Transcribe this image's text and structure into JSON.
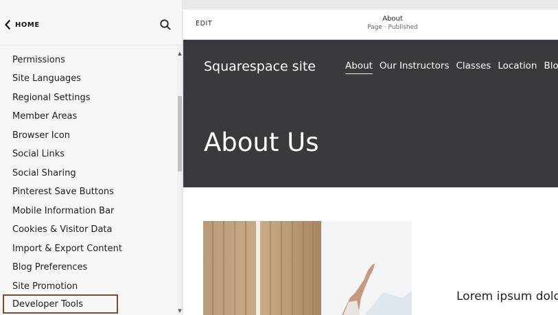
{
  "sidebar": {
    "back_label": "HOME",
    "items": [
      {
        "label": "Permissions"
      },
      {
        "label": "Site Languages"
      },
      {
        "label": "Regional Settings"
      },
      {
        "label": "Member Areas"
      },
      {
        "label": "Browser Icon"
      },
      {
        "label": "Social Links"
      },
      {
        "label": "Social Sharing"
      },
      {
        "label": "Pinterest Save Buttons"
      },
      {
        "label": "Mobile Information Bar"
      },
      {
        "label": "Cookies & Visitor Data"
      },
      {
        "label": "Import & Export Content"
      },
      {
        "label": "Blog Preferences"
      },
      {
        "label": "Site Promotion"
      },
      {
        "label": "Developer Tools",
        "highlighted": true
      }
    ],
    "highlight_color": "#7a4a2c"
  },
  "preview": {
    "edit_label": "EDIT",
    "page_name": "About",
    "page_status": "Page · Published",
    "site_title": "Squarespace site",
    "nav": [
      {
        "label": "About",
        "active": true
      },
      {
        "label": "Our Instructors"
      },
      {
        "label": "Classes"
      },
      {
        "label": "Location"
      },
      {
        "label": "Blog"
      }
    ],
    "hero_heading": "About Us",
    "hero_color": "#3a393d",
    "body_text": "Lorem ipsum dolo"
  },
  "icons": {
    "back": "chevron-left-icon",
    "search": "search-icon"
  }
}
